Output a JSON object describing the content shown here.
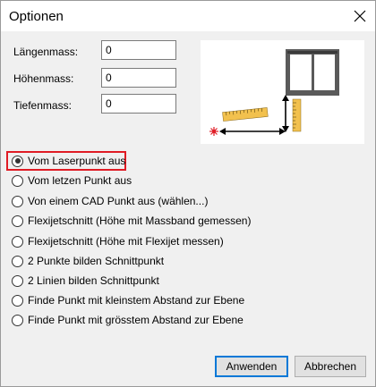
{
  "dialog": {
    "title": "Optionen"
  },
  "fields": [
    {
      "label": "Längenmass:",
      "value": "0"
    },
    {
      "label": "Höhenmass:",
      "value": "0"
    },
    {
      "label": "Tiefenmass:",
      "value": "0"
    }
  ],
  "options": [
    {
      "label": "Vom Laserpunkt aus",
      "checked": true
    },
    {
      "label": "Vom letzen Punkt aus",
      "checked": false
    },
    {
      "label": "Von einem CAD Punkt aus (wählen...)",
      "checked": false
    },
    {
      "label": "Flexijetschnitt (Höhe mit Massband gemessen)",
      "checked": false
    },
    {
      "label": "Flexijetschnitt (Höhe mit Flexijet messen)",
      "checked": false
    },
    {
      "label": "2 Punkte bilden Schnittpunkt",
      "checked": false
    },
    {
      "label": "2 Linien bilden Schnittpunkt",
      "checked": false
    },
    {
      "label": "Finde Punkt mit kleinstem Abstand zur Ebene",
      "checked": false
    },
    {
      "label": "Finde Punkt mit grösstem Abstand zur Ebene",
      "checked": false
    }
  ],
  "buttons": {
    "ok_label": "Anwenden",
    "cancel_label": "Abbrechen"
  },
  "icons": {
    "close": "close-icon",
    "illustration": "measurement-illustration"
  },
  "colors": {
    "highlight": "#e01b24",
    "primary_button_border": "#0078d7",
    "ruler": "#f2c14e",
    "laser_point": "#e01b24"
  }
}
